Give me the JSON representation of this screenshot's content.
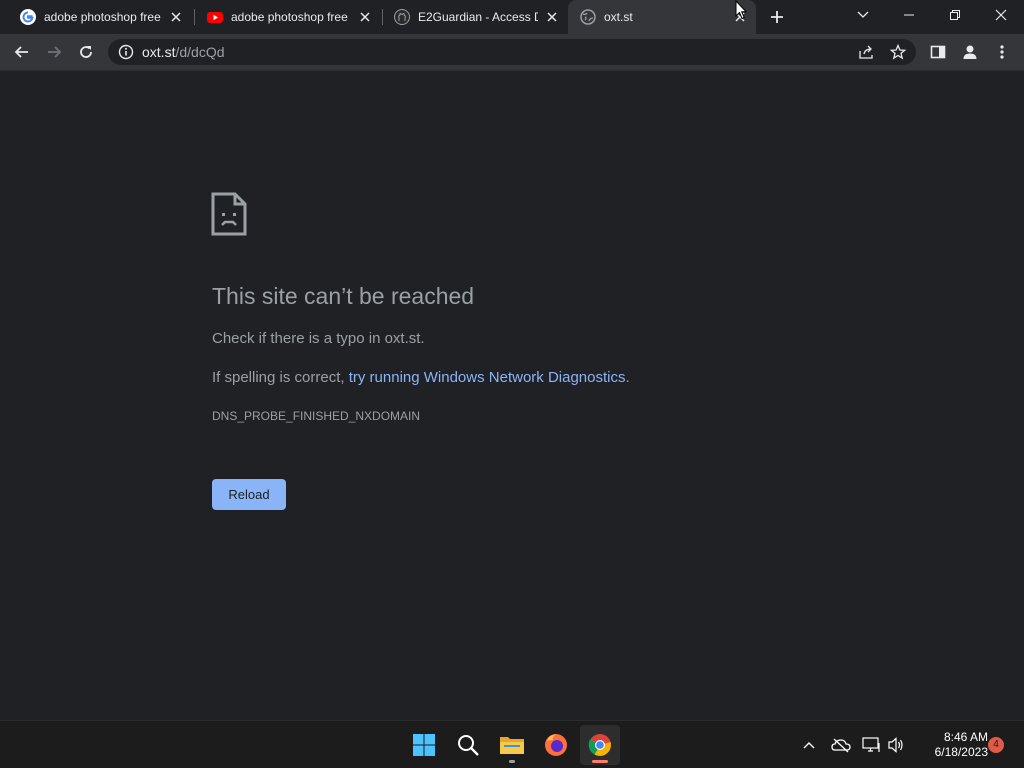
{
  "tabs": [
    {
      "title": "adobe photoshop free",
      "favicon": "google-icon",
      "active": false
    },
    {
      "title": "adobe photoshop free",
      "favicon": "youtube-icon",
      "active": false
    },
    {
      "title": "E2Guardian - Access De",
      "favicon": "github-icon",
      "active": false
    },
    {
      "title": "oxt.st",
      "favicon": "globe-icon",
      "active": true
    }
  ],
  "address_bar": {
    "host": "oxt.st",
    "path": "/d/dcQd"
  },
  "error_page": {
    "headline": "This site can’t be reached",
    "line1": "Check if there is a typo in oxt.st.",
    "line2_prefix": "If spelling is correct, ",
    "line2_link": "try running Windows Network Diagnostics",
    "line2_suffix": ".",
    "error_code": "DNS_PROBE_FINISHED_NXDOMAIN",
    "reload_label": "Reload"
  },
  "taskbar": {
    "apps": [
      "windows-start-icon",
      "search-icon",
      "file-explorer-icon",
      "firefox-icon",
      "chrome-icon"
    ],
    "time": "8:46 AM",
    "date": "6/18/2023",
    "notification_count": "4"
  },
  "colors": {
    "background": "#202124",
    "toolbar": "#35363a",
    "link": "#8ab4f8",
    "button": "#8ab4f8",
    "text_muted": "#9aa0a6"
  }
}
